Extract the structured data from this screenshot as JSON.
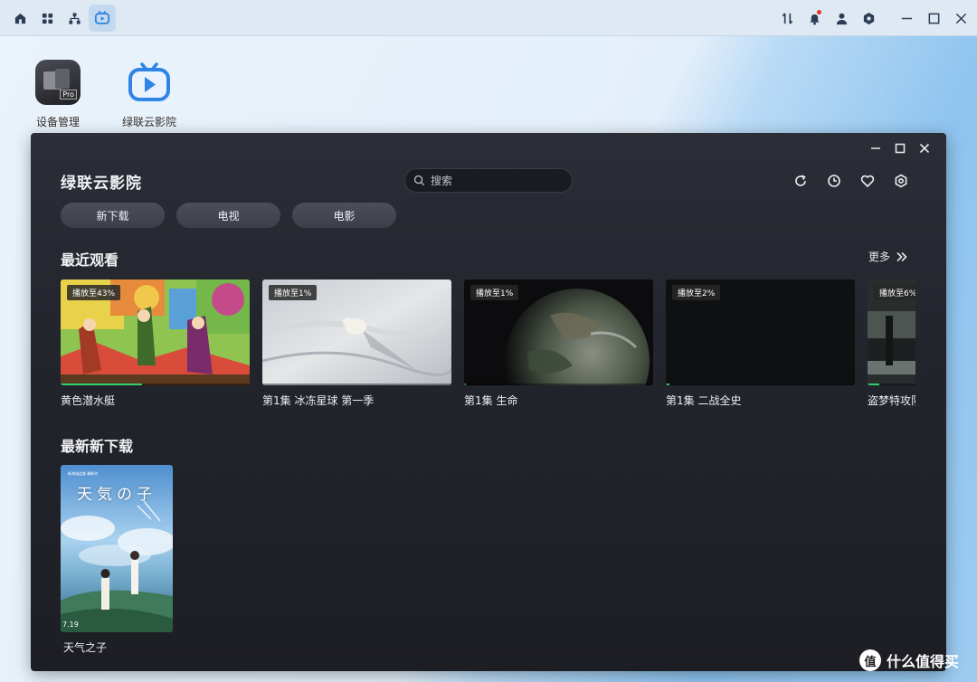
{
  "os_bar": {
    "left_icons": [
      "home-icon",
      "apps-grid-icon",
      "network-icon",
      "tv-app-icon"
    ],
    "right_icons": [
      "transfer-icon",
      "notification-bell-icon",
      "user-icon",
      "settings-icon",
      "minimize-icon",
      "maximize-icon",
      "close-icon"
    ]
  },
  "desktop": {
    "icons": [
      {
        "label": "设备管理",
        "icon": "device-manager-icon"
      },
      {
        "label": "绿联云影院",
        "icon": "cinema-app-icon"
      }
    ]
  },
  "app": {
    "title": "绿联云影院",
    "search": {
      "placeholder": "搜索"
    },
    "toolbar_icons": [
      "refresh-icon",
      "history-icon",
      "favorite-icon",
      "settings-icon"
    ],
    "tabs": [
      "新下载",
      "电视",
      "电影"
    ],
    "recent": {
      "title": "最近观看",
      "more_label": "更多",
      "items": [
        {
          "title": "黄色潜水艇",
          "badge": "播放至43%",
          "progress": 43
        },
        {
          "title": "第1集 冰冻星球 第一季",
          "badge": "播放至1%",
          "progress": 1
        },
        {
          "title": "第1集 生命",
          "badge": "播放至1%",
          "progress": 1
        },
        {
          "title": "第1集 二战全史",
          "badge": "播放至2%",
          "progress": 2
        },
        {
          "title": "盗梦特攻队",
          "badge": "播放至6%",
          "progress": 6
        }
      ]
    },
    "latest": {
      "title": "最新新下载",
      "items": [
        {
          "title": "天气之子",
          "poster_text": "天気の子",
          "poster_date": "7.19"
        }
      ]
    }
  },
  "watermark": {
    "symbol": "值",
    "text": "什么值得买"
  },
  "colors": {
    "accent_progress": "#2fd06d",
    "window_bg": "#23252d",
    "desktop_blue": "#8ec4ef"
  }
}
